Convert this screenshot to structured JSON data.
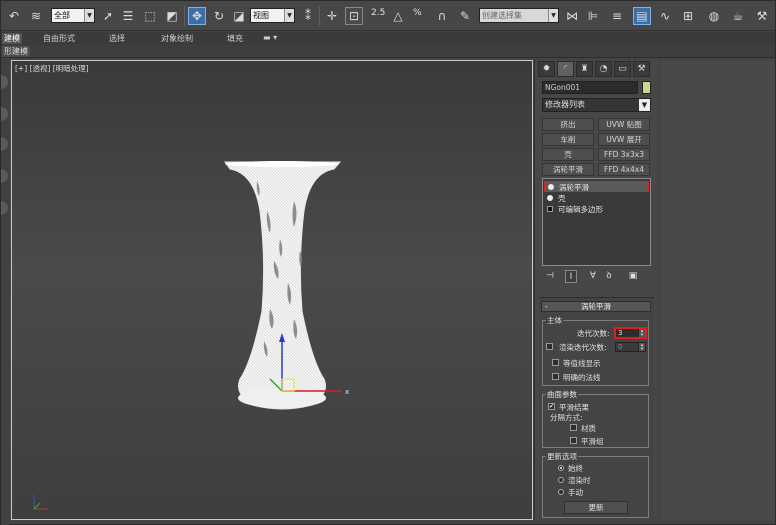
{
  "toolbar": {
    "selection_filter": "全部",
    "ref_coord": "视图",
    "angle_snap_label": "2.5",
    "percent_snap_label": "%",
    "selection_set_placeholder": "创建选择集"
  },
  "ribbon": {
    "tabs": [
      "建模",
      "自由形式",
      "选择",
      "对象绘制",
      "填充"
    ],
    "active_tab": "建模",
    "sub_label": "形建模"
  },
  "viewport": {
    "label": "[+] [透视] [明暗处理]"
  },
  "command_panel": {
    "object_name": "NGon001",
    "object_color": "#c6d98c",
    "modifier_list": "修改器列表",
    "modifier_buttons": [
      "挤出",
      "UVW 贴图",
      "车削",
      "UVW 展开",
      "壳",
      "FFD 3x3x3",
      "涡轮平滑",
      "FFD 4x4x4"
    ],
    "stack": [
      {
        "label": "涡轮平滑",
        "type": "modifier",
        "highlighted": true
      },
      {
        "label": "壳",
        "type": "modifier",
        "highlighted": false
      },
      {
        "label": "可编辑多边形",
        "type": "base",
        "highlighted": false
      }
    ]
  },
  "rollout": {
    "title": "涡轮平滑",
    "main_group": "主体",
    "iterations_label": "迭代次数:",
    "iterations_value": "3",
    "render_iters_label": "渲染迭代次数:",
    "render_iters_value": "0",
    "isoline_label": "等值线显示",
    "explicit_normals_label": "明确的法线",
    "surface_group": "曲面参数",
    "smooth_result_label": "平滑结果",
    "separate_by_label": "分隔方式:",
    "materials_label": "材质",
    "smoothing_groups_label": "平滑组",
    "update_group": "更新选项",
    "always_label": "始终",
    "when_rendering_label": "渲染时",
    "manual_label": "手动",
    "update_button": "更新"
  }
}
